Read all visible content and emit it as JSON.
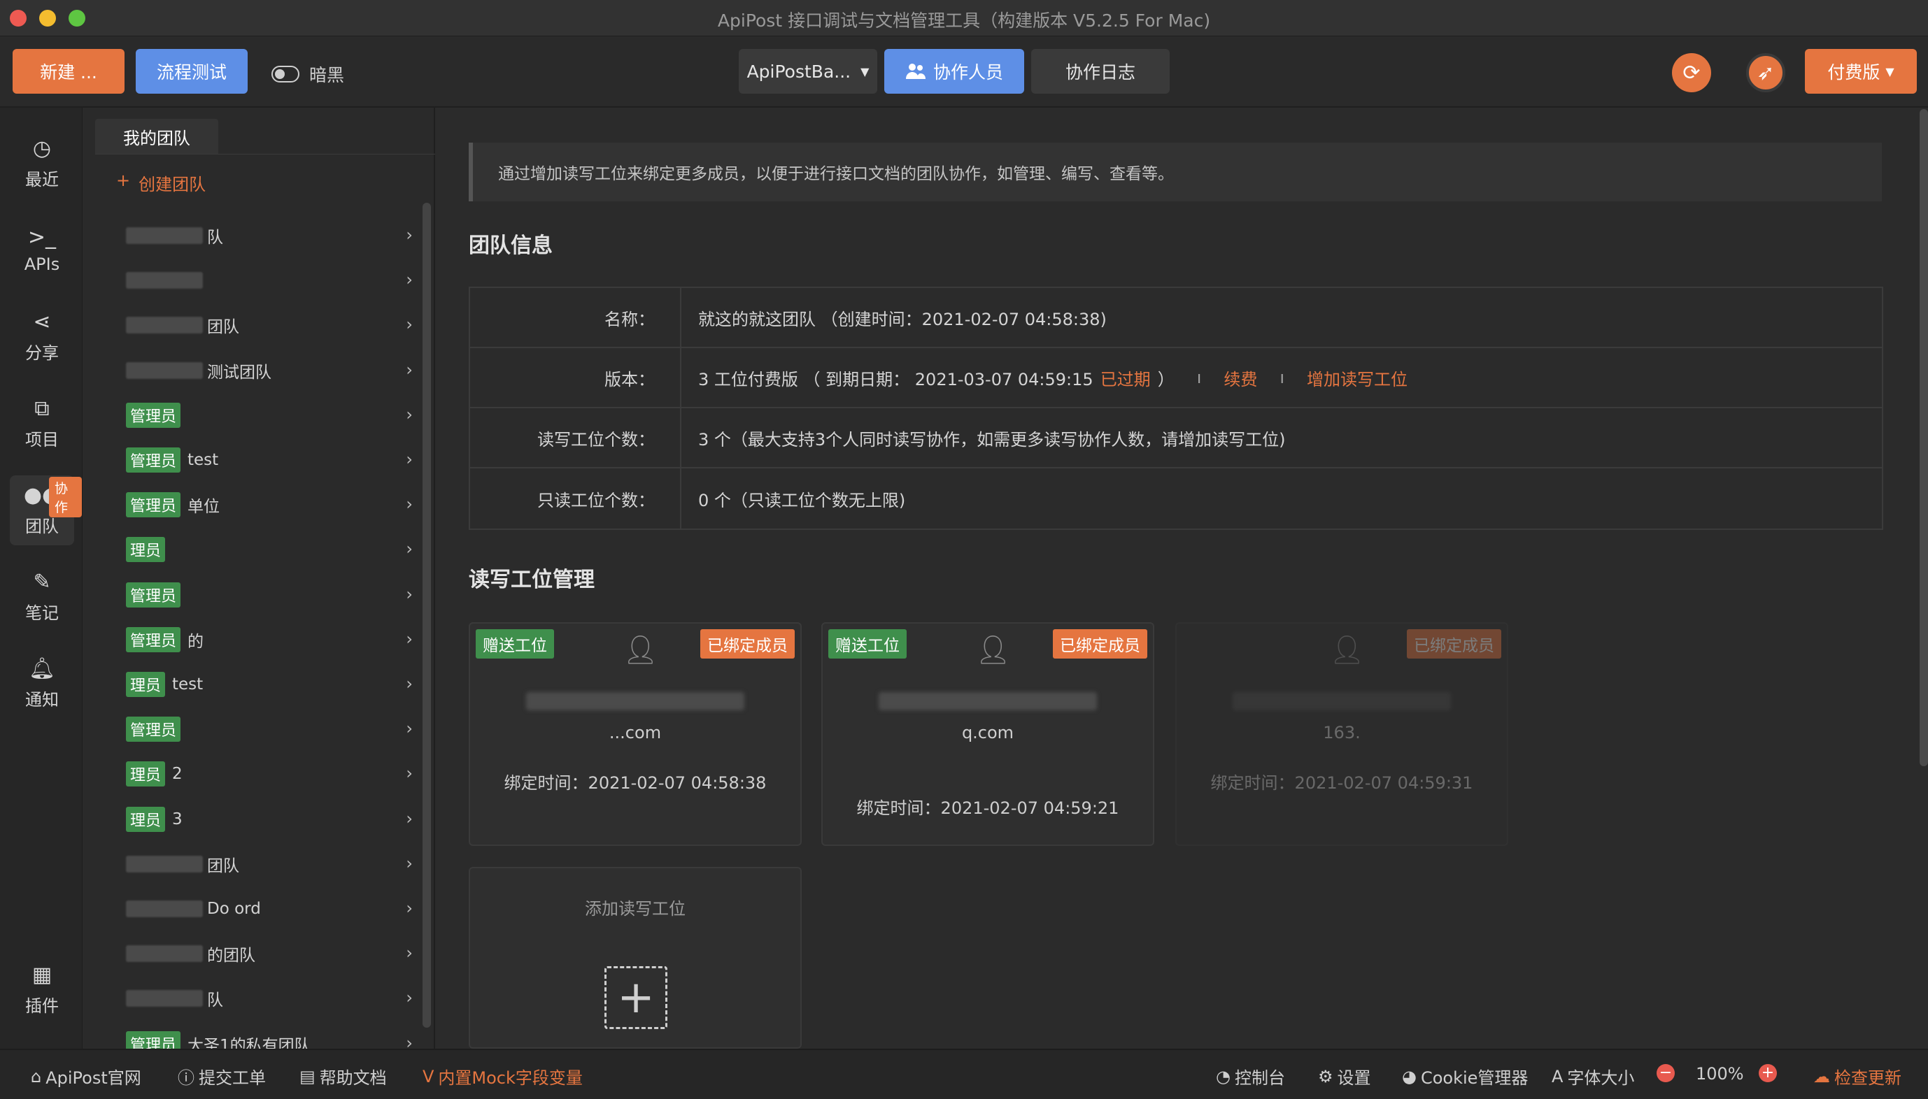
{
  "window": {
    "title": "ApiPost 接口调试与文档管理工具（构建版本 V5.2.5 For Mac)"
  },
  "toolbar": {
    "new_label": "新建 ...",
    "flow_label": "流程测试",
    "dark_label": "暗黑",
    "workspace_label": "ApiPostBa...",
    "collab_label": "协作人员",
    "log_label": "协作日志",
    "paid_label": "付费版"
  },
  "rail": {
    "items": [
      {
        "label": "最近",
        "icon": "clock-icon"
      },
      {
        "label": "APIs",
        "icon": "terminal-icon"
      },
      {
        "label": "分享",
        "icon": "share-icon"
      },
      {
        "label": "项目",
        "icon": "project-icon"
      },
      {
        "label": "团队",
        "icon": "team-icon"
      },
      {
        "label": "笔记",
        "icon": "note-icon"
      },
      {
        "label": "通知",
        "icon": "bell-icon"
      },
      {
        "label": "插件",
        "icon": "plugin-icon"
      }
    ],
    "badge": "协作"
  },
  "teams": {
    "header": "我的团队",
    "create_label": "创建团队",
    "items": [
      {
        "tag": "",
        "text": "队"
      },
      {
        "tag": "",
        "text": ""
      },
      {
        "tag": "",
        "text": "团队"
      },
      {
        "tag": "",
        "text": "测试团队"
      },
      {
        "tag": "管理员",
        "text": ""
      },
      {
        "tag": "管理员",
        "text": "test"
      },
      {
        "tag": "管理员",
        "text": "单位"
      },
      {
        "tag": "理员",
        "text": ""
      },
      {
        "tag": "管理员",
        "text": ""
      },
      {
        "tag": "管理员",
        "text": "的"
      },
      {
        "tag": "理员",
        "text": "test"
      },
      {
        "tag": "管理员",
        "text": ""
      },
      {
        "tag": "理员",
        "text": "2"
      },
      {
        "tag": "理员",
        "text": "3"
      },
      {
        "tag": "",
        "text": "团队"
      },
      {
        "tag": "",
        "text": "Do  ord"
      },
      {
        "tag": "",
        "text": "的团队"
      },
      {
        "tag": "",
        "text": "队"
      },
      {
        "tag": "管理员",
        "text": "大圣1的私有团队"
      }
    ]
  },
  "main": {
    "notice": "通过增加读写工位来绑定更多成员，以便于进行接口文档的团队协作，如管理、编写、查看等。",
    "info_title": "团队信息",
    "info": {
      "name_label": "名称：",
      "name_value": "就这的就这团队 （创建时间：2021-02-07 04:58:38)",
      "version_label": "版本：",
      "version_value": "3 工位付费版 （ 到期日期： 2021-03-07 04:59:15",
      "expired": "已过期",
      "version_close": "）",
      "renew": "续费",
      "add_seat": "增加读写工位",
      "rw_label": "读写工位个数：",
      "rw_value": "3 个（最大支持3个人同时读写协作，如需更多读写协作人数，请增加读写工位)",
      "ro_label": "只读工位个数：",
      "ro_value": "0 个（只读工位个数无上限)"
    },
    "seats_title": "读写工位管理",
    "cards": [
      {
        "tag_left": "赠送工位",
        "tag_right": "已绑定成员",
        "email": "...com",
        "time": "绑定时间：2021-02-07 04:58:38"
      },
      {
        "tag_left": "赠送工位",
        "tag_right": "已绑定成员",
        "email": "q.com",
        "time": "绑定时间：2021-02-07 04:59:21"
      },
      {
        "tag_left": "",
        "tag_right": "已绑定成员",
        "email": "163.",
        "time": "绑定时间：2021-02-07 04:59:31"
      }
    ],
    "add_card_label": "添加读写工位"
  },
  "statusbar": {
    "home": "ApiPost官网",
    "ticket": "提交工单",
    "docs": "帮助文档",
    "mock": "内置Mock字段变量",
    "console": "控制台",
    "settings": "设置",
    "cookie": "Cookie管理器",
    "font": "字体大小",
    "zoom": "100%",
    "update": "检查更新"
  },
  "colors": {
    "accent": "#e57540",
    "primary": "#5e8fe6",
    "tag_green": "#3f8f4c"
  }
}
